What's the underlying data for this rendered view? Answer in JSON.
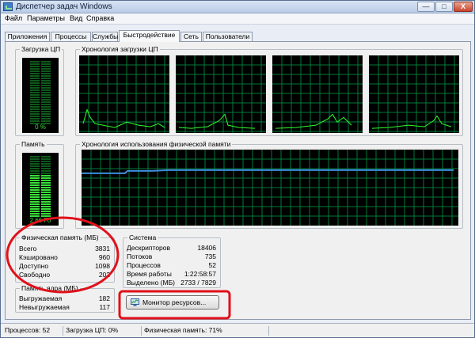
{
  "window": {
    "title": "Диспетчер задач Windows",
    "buttons": {
      "minimize": "—",
      "maximize": "□",
      "close": "X"
    }
  },
  "menu": {
    "items": [
      "Файл",
      "Параметры",
      "Вид",
      "Справка"
    ]
  },
  "tabs": {
    "items": [
      "Приложения",
      "Процессы",
      "Службы",
      "Быстродействие",
      "Сеть",
      "Пользователи"
    ],
    "active": "Быстродействие"
  },
  "cpu": {
    "meter_title": "Загрузка ЦП",
    "meter_value": "0 %",
    "meter_level": 0,
    "history_title": "Хронология загрузки ЦП",
    "core_count": 4
  },
  "memory": {
    "meter_title": "Память",
    "meter_value": "2,66 Гб",
    "meter_level": 0.71,
    "history_title": "Хронология использования физической памяти"
  },
  "physical_memory": {
    "title": "Физическая память (МБ)",
    "rows": [
      {
        "label": "Всего",
        "value": "3831"
      },
      {
        "label": "Кэшировано",
        "value": "960"
      },
      {
        "label": "Доступно",
        "value": "1098"
      },
      {
        "label": "Свободно",
        "value": "202"
      }
    ]
  },
  "kernel_memory": {
    "title": "Память ядра (МБ)",
    "rows": [
      {
        "label": "Выгружаемая",
        "value": "182"
      },
      {
        "label": "Невыгружаемая",
        "value": "117"
      }
    ]
  },
  "system": {
    "title": "Система",
    "rows": [
      {
        "label": "Дескрипторов",
        "value": "18406"
      },
      {
        "label": "Потоков",
        "value": "735"
      },
      {
        "label": "Процессов",
        "value": "52"
      },
      {
        "label": "Время работы",
        "value": "1:22:58:57"
      },
      {
        "label": "Выделено (МБ)",
        "value": "2733 / 7829"
      }
    ]
  },
  "resource_monitor_button": "Монитор ресурсов...",
  "status_bar": {
    "processes": "Процессов: 52",
    "cpu": "Загрузка ЦП: 0%",
    "memory": "Физическая память: 71%"
  },
  "colors": {
    "grid": "#007a3a",
    "cpu_line": "#2cff2c",
    "mem_line": "#3c8dde",
    "meter_lit": "#38e038",
    "meter_dim": "#0e5a1a",
    "annotation": "#e0101a"
  }
}
